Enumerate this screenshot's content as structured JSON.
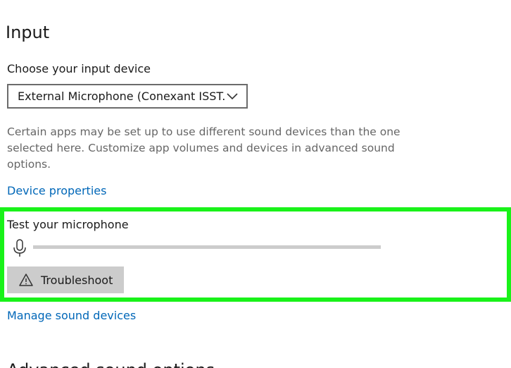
{
  "input": {
    "title": "Input",
    "device_label": "Choose your input device",
    "device_selected": "External Microphone (Conexant ISST...",
    "description": "Certain apps may be set up to use different sound devices than the one selected here. Customize app volumes and devices in advanced sound options.",
    "device_properties_link": "Device properties"
  },
  "test": {
    "label": "Test your microphone",
    "level_percent": 0,
    "troubleshoot_label": "Troubleshoot"
  },
  "manage_link": "Manage sound devices",
  "next_section_title": "Advanced sound options",
  "icons": {
    "dropdown": "chevron-down-icon",
    "microphone": "microphone-icon",
    "troubleshoot": "warning-icon"
  },
  "colors": {
    "link": "#0067b8",
    "highlight": "#19f219",
    "meter_track": "#cccccc",
    "button_bg": "#cccccc"
  }
}
